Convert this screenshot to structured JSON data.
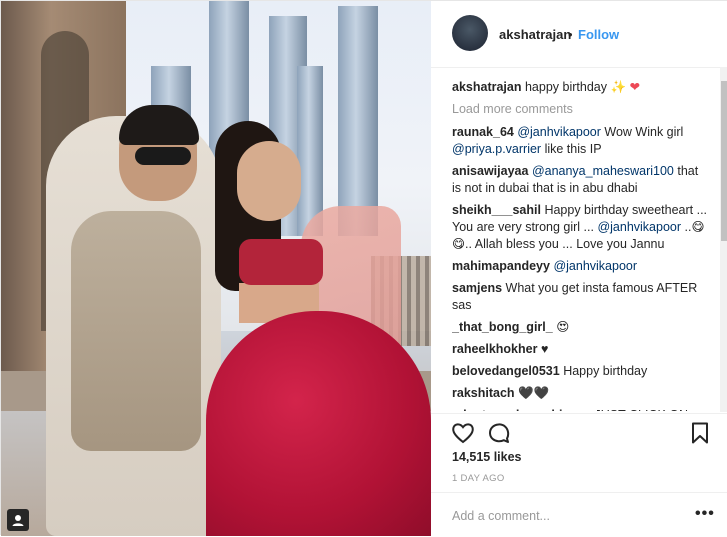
{
  "post": {
    "username": "akshatrajan",
    "separator": "•",
    "follow_label": "Follow",
    "caption": {
      "username": "akshatrajan",
      "text": "happy birthday",
      "emojis": [
        "✨",
        "❤"
      ]
    },
    "load_more_label": "Load more comments",
    "comments": [
      {
        "user": "raunak_64",
        "parts": [
          {
            "t": "mention",
            "v": "@janhvikapoor"
          },
          {
            "t": "text",
            "v": " Wow Wink girl "
          },
          {
            "t": "mention",
            "v": "@priya.p.varrier"
          },
          {
            "t": "text",
            "v": " like this IP"
          }
        ]
      },
      {
        "user": "anisawijayaa",
        "parts": [
          {
            "t": "mention",
            "v": "@ananya_maheswari100"
          },
          {
            "t": "text",
            "v": " that is not in dubai that is in abu dhabi"
          }
        ]
      },
      {
        "user": "sheikh___sahil",
        "parts": [
          {
            "t": "text",
            "v": "Happy birthday sweetheart ... You are very strong girl ... "
          },
          {
            "t": "mention",
            "v": "@janhvikapoor"
          },
          {
            "t": "text",
            "v": " ..😋 😋.. Allah bless you ... Love you Jannu"
          }
        ]
      },
      {
        "user": "mahimapandeyy",
        "parts": [
          {
            "t": "mention",
            "v": "@janhvikapoor"
          }
        ]
      },
      {
        "user": "samjens",
        "parts": [
          {
            "t": "text",
            "v": "What you get insta famous AFTER sas"
          }
        ]
      },
      {
        "user": "_that_bong_girl_",
        "parts": [
          {
            "t": "text",
            "v": "😍"
          }
        ]
      },
      {
        "user": "raheelkhokher",
        "parts": [
          {
            "t": "text",
            "v": "♥"
          }
        ]
      },
      {
        "user": "belovedangel0531",
        "parts": [
          {
            "t": "text",
            "v": "Happy birthday"
          }
        ]
      },
      {
        "user": "rakshitach",
        "parts": [
          {
            "t": "text",
            "v": "🖤🖤"
          }
        ]
      },
      {
        "user": "_dont_read_my_bio_",
        "parts": [
          {
            "t": "text",
            "v": "✔ JUST CLICK ON"
          }
        ]
      }
    ],
    "likes_text": "14,515 likes",
    "time_text": "1 DAY AGO",
    "add_comment_placeholder": "Add a comment...",
    "more_label": "•••"
  },
  "icons": {
    "like": "heart-outline-icon",
    "comment": "comment-bubble-icon",
    "save": "bookmark-icon",
    "tagged_user": "user-tag-icon"
  },
  "colors": {
    "link": "#3897f0",
    "mention": "#003569",
    "muted": "#999999",
    "heart": "#ed4956"
  }
}
